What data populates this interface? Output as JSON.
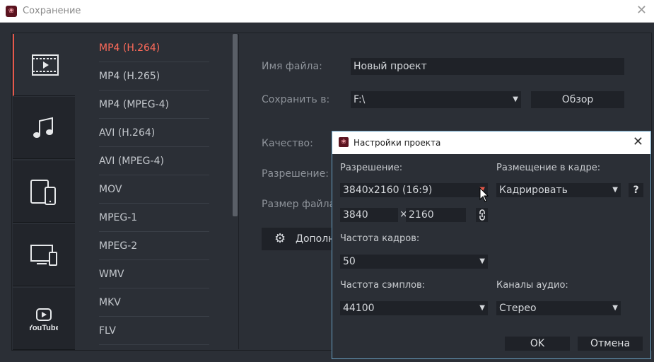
{
  "window": {
    "title": "Сохранение"
  },
  "categories": [
    {
      "id": "video",
      "icon": "film-icon"
    },
    {
      "id": "audio",
      "icon": "music-note-icon"
    },
    {
      "id": "devices",
      "icon": "tablet-phone-icon"
    },
    {
      "id": "tv",
      "icon": "tv-icon"
    },
    {
      "id": "youtube",
      "icon": "youtube-icon",
      "label": "YouTube"
    }
  ],
  "formats": [
    "MP4 (H.264)",
    "MP4 (H.265)",
    "MP4 (MPEG-4)",
    "AVI (H.264)",
    "AVI (MPEG-4)",
    "MOV",
    "MPEG-1",
    "MPEG-2",
    "WMV",
    "MKV",
    "FLV"
  ],
  "form": {
    "filename_label": "Имя файла:",
    "filename_value": "Новый проект",
    "save_to_label": "Сохранить в:",
    "save_to_value": "F:\\",
    "browse_label": "Обзор",
    "quality_label": "Качество:",
    "resolution_label": "Разрешение:",
    "filesize_label": "Размер файла",
    "advanced_label": "Дополн"
  },
  "dialog": {
    "title": "Настройки проекта",
    "resolution_label": "Разрешение:",
    "resolution_value": "3840x2160 (16:9)",
    "width_value": "3840",
    "times": "×",
    "height_value": "2160",
    "placement_label": "Размещение в кадре:",
    "placement_value": "Кадрировать",
    "help_label": "?",
    "framerate_label": "Частота кадров:",
    "framerate_value": "50",
    "samplerate_label": "Частота сэмплов:",
    "samplerate_value": "44100",
    "channels_label": "Каналы аудио:",
    "channels_value": "Стерео",
    "ok_label": "OK",
    "cancel_label": "Отмена"
  },
  "colors": {
    "accent": "#ff6b5a",
    "background": "#2b2f36",
    "field": "#1f2228"
  }
}
